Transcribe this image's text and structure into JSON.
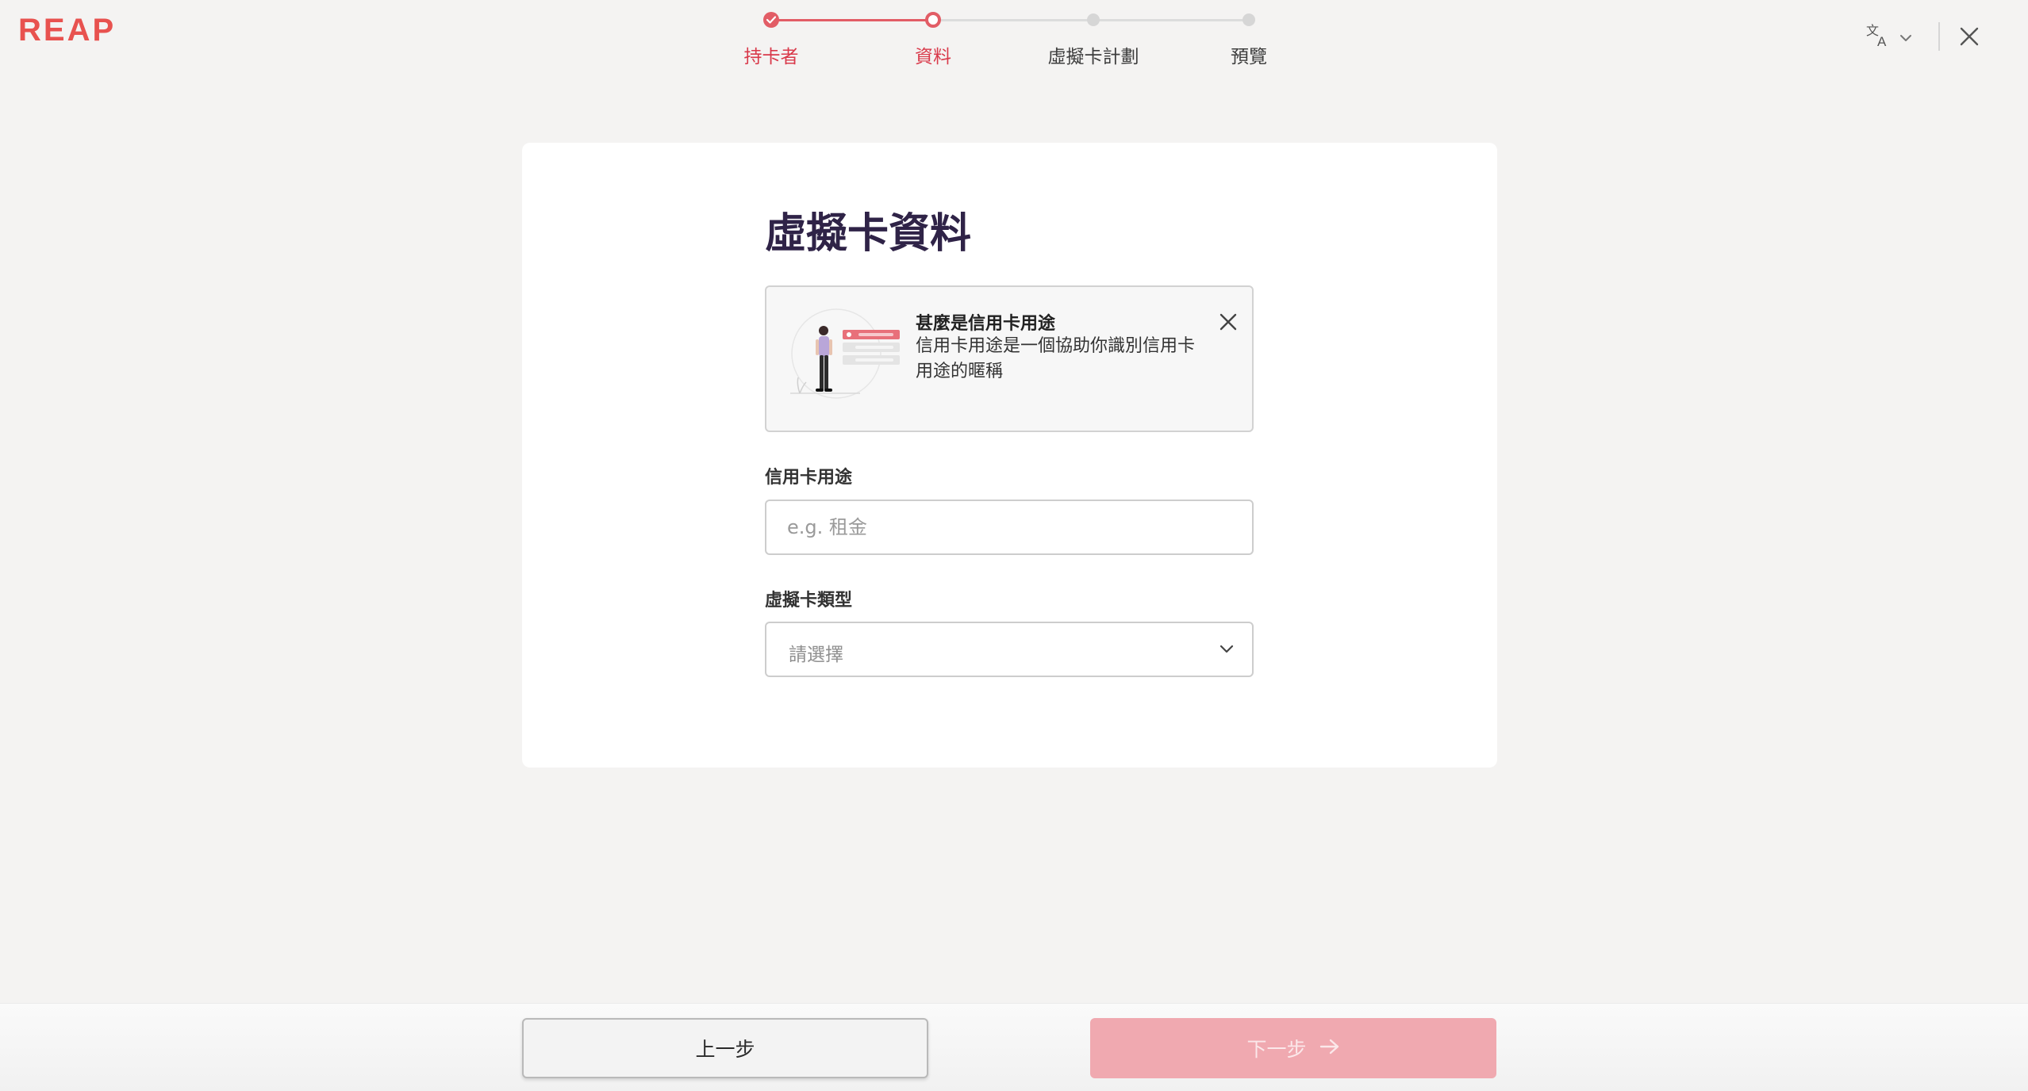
{
  "brand": {
    "logo_text": "REAP",
    "accent_color": "#e25d66"
  },
  "stepper": {
    "steps": [
      {
        "label": "持卡者",
        "state": "done"
      },
      {
        "label": "資料",
        "state": "current"
      },
      {
        "label": "虛擬卡計劃",
        "state": "todo"
      },
      {
        "label": "預覽",
        "state": "todo"
      }
    ]
  },
  "header": {
    "language_icon": "translate-icon",
    "close_icon": "close-icon"
  },
  "form": {
    "title": "虛擬卡資料",
    "info": {
      "title": "甚麼是信用卡用途",
      "description": "信用卡用途是一個協助你識別信用卡用途的暱稱"
    },
    "purpose": {
      "label": "信用卡用途",
      "placeholder": "e.g. 租金",
      "value": ""
    },
    "card_type": {
      "label": "虛擬卡類型",
      "selected": "請選擇"
    }
  },
  "footer": {
    "prev_label": "上一步",
    "next_label": "下一步"
  }
}
